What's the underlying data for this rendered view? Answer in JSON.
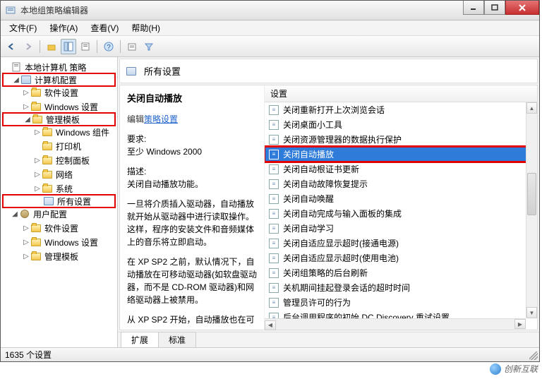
{
  "window": {
    "title": "本地组策略编辑器"
  },
  "menu": {
    "file": "文件(F)",
    "action": "操作(A)",
    "view": "查看(V)",
    "help": "帮助(H)"
  },
  "tree": {
    "root": "本地计算机 策略",
    "computer_cfg": "计算机配置",
    "software_settings": "软件设置",
    "windows_settings": "Windows 设置",
    "admin_templates": "管理模板",
    "windows_components": "Windows 组件",
    "printers": "打印机",
    "control_panel": "控制面板",
    "network": "网络",
    "system": "系统",
    "all_settings": "所有设置",
    "user_cfg": "用户配置",
    "u_software": "软件设置",
    "u_windows": "Windows 设置",
    "u_admin": "管理模板"
  },
  "header": {
    "icon_name": "settings-list-icon",
    "title": "所有设置"
  },
  "detail": {
    "title": "关闭自动播放",
    "edit_label": "编辑",
    "policy_link": "策略设置",
    "req_label": "要求:",
    "req_value": "至少 Windows 2000",
    "desc_label": "描述:",
    "desc_line1": "关闭自动播放功能。",
    "para1": "一旦将介质插入驱动器，自动播放就开始从驱动器中进行读取操作。这样，程序的安装文件和音频媒体上的音乐将立即启动。",
    "para2": "在 XP SP2 之前，默认情况下，自动播放在可移动驱动器(如软盘驱动器，而不是 CD-ROM 驱动器)和网络驱动器上被禁用。",
    "para3": "从 XP SP2 开始，自动播放也在可"
  },
  "list": {
    "column": "设置",
    "items": [
      "关闭重新打开上次浏览会话",
      "关闭桌面小工具",
      "关闭资源管理器的数据执行保护",
      "关闭自动播放",
      "关闭自动根证书更新",
      "关闭自动故障恢复提示",
      "关闭自动唤醒",
      "关闭自动完成与输入面板的集成",
      "关闭自动学习",
      "关闭自适应显示超时(接通电源)",
      "关闭自适应显示超时(使用电池)",
      "关闭组策略的后台刷新",
      "关机期间挂起登录会话的超时时间",
      "管理员许可的行为",
      "后台调用程序的初始 DC Discovery 重试设置"
    ],
    "selected_index": 3
  },
  "tabs": {
    "extended": "扩展",
    "standard": "标准"
  },
  "status": {
    "text": "1635 个设置"
  },
  "watermark": {
    "text": "创新互联"
  }
}
